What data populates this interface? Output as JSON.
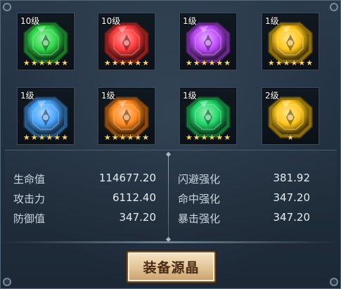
{
  "gems": [
    {
      "level": "10级",
      "stars": 6,
      "color": "green",
      "hex": "#2fd84a"
    },
    {
      "level": "10级",
      "stars": 6,
      "color": "red",
      "hex": "#ff3b3b"
    },
    {
      "level": "1级",
      "stars": 6,
      "color": "purple",
      "hex": "#c04dff"
    },
    {
      "level": "1级",
      "stars": 6,
      "color": "gold",
      "hex": "#ffc61a"
    },
    {
      "level": "1级",
      "stars": 6,
      "color": "blue",
      "hex": "#4aa6ff"
    },
    {
      "level": "1级",
      "stars": 6,
      "color": "orange",
      "hex": "#ff8a1f"
    },
    {
      "level": "1级",
      "stars": 6,
      "color": "green",
      "hex": "#22d86a"
    },
    {
      "level": "2级",
      "stars": 1,
      "color": "gold",
      "hex": "#ffc61a"
    }
  ],
  "stats_left": [
    {
      "label": "生命值",
      "value": "114677.20"
    },
    {
      "label": "攻击力",
      "value": "6112.40"
    },
    {
      "label": "防御值",
      "value": "347.20"
    }
  ],
  "stats_right": [
    {
      "label": "闪避强化",
      "value": "381.92"
    },
    {
      "label": "命中强化",
      "value": "347.20"
    },
    {
      "label": "暴击强化",
      "value": "347.20"
    }
  ],
  "button": {
    "label": "装备源晶"
  }
}
